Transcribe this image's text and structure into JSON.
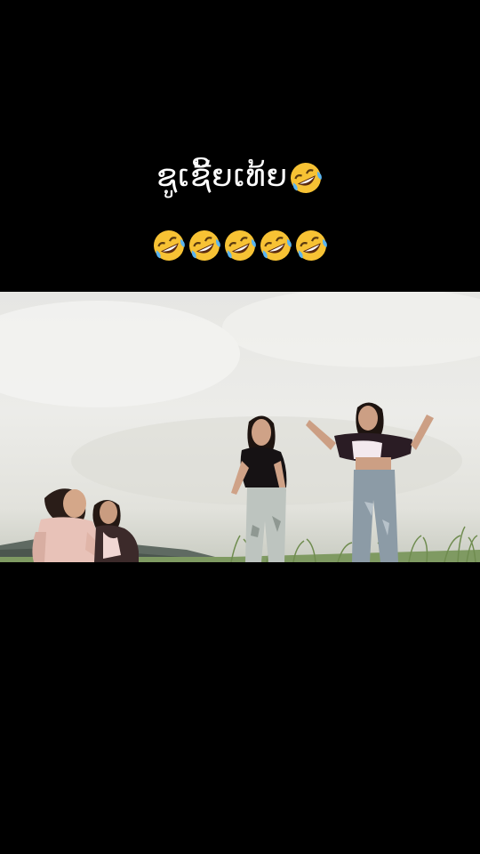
{
  "caption": {
    "line1_text": "ຊູເຊີ້ຍເທ້ຍ",
    "line1_emoji": "rolling-on-floor-laughing-emoji",
    "line2_emoji_count": 5,
    "line2_emoji": "rolling-on-floor-laughing-emoji"
  },
  "video": {
    "scene": "four-girls-on-grassy-hill"
  },
  "colors": {
    "background": "#000000",
    "caption_text": "#ffffff",
    "emoji_face": "#f7c234",
    "emoji_tear": "#5ab4f0"
  }
}
